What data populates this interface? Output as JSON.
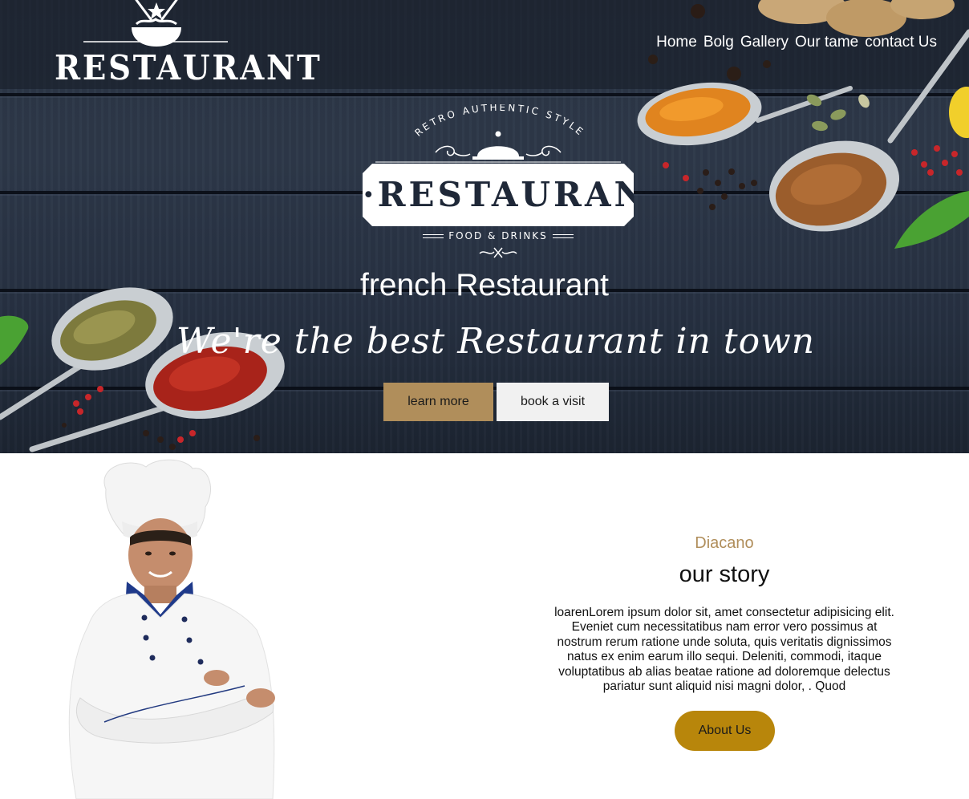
{
  "brand": {
    "logo_text": "RESTAURANT"
  },
  "nav": {
    "items": [
      "Home",
      "Bolg",
      "Gallery",
      "Our tame",
      "contact Us"
    ]
  },
  "hero": {
    "badge": {
      "arc_text": "RETRO AUTHENTIC STYLE",
      "title": "·RESTAURANT·",
      "subtitle": "FOOD & DRINKS"
    },
    "title": "french Restaurant",
    "tagline": "We're the best Restaurant in town",
    "learn_more_label": "learn more",
    "book_visit_label": "book a visit"
  },
  "story": {
    "kicker": "Diacano",
    "title": "our story",
    "body": "loarenLorem ipsum dolor sit, amet consectetur adipisicing elit. Eveniet cum necessitatibus nam error vero possimus at nostrum rerum ratione unde soluta, quis veritatis dignissimos natus ex enim earum illo sequi. Deleniti, commodi, itaque voluptatibus ab alias beatae ratione ad doloremque delectus pariatur sunt aliquid nisi magni dolor, . Quod",
    "button_label": "About Us"
  },
  "colors": {
    "accent_gold": "#b08e5b",
    "button_gold": "#b8860b",
    "hero_wood": "#2b3544",
    "text_dark": "#111111"
  }
}
